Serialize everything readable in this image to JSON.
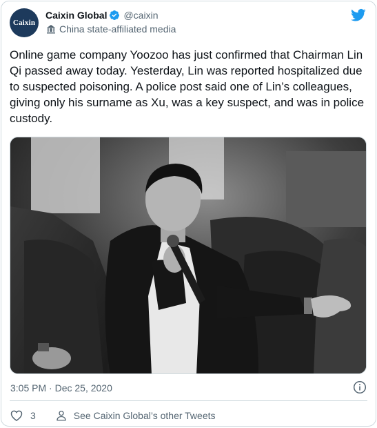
{
  "header": {
    "avatar_text": "Caixin",
    "display_name": "Caixin Global",
    "handle": "@caixin",
    "label": "China state-affiliated media",
    "verified_icon": "verified-badge-icon",
    "label_icon": "state-media-icon",
    "logo_icon": "twitter-bird-icon"
  },
  "tweet": {
    "text": "Online game company Yoozoo has just confirmed that Chairman Lin Qi passed away today. Yesterday, Lin was reported hospitalized due to suspected poisoning. A police post said one of Lin’s colleagues, giving only his surname as Xu, was a key suspect, and was in police custody.",
    "timestamp": "3:05 PM · Dec 25, 2020"
  },
  "actions": {
    "like_count": "3",
    "profile_link": "See Caixin Global’s other Tweets"
  },
  "colors": {
    "twitter_blue": "#1d9bf0",
    "text_primary": "#0f1419",
    "text_secondary": "#536471",
    "border": "#cfd9de"
  }
}
